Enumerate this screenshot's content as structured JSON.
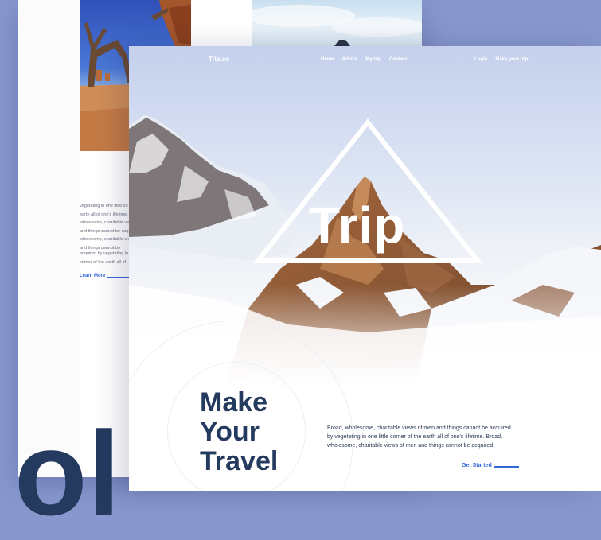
{
  "nav": {
    "brand": "Trip.co",
    "links": [
      "Home",
      "Advice",
      "My trip",
      "Contact"
    ],
    "login": "Login",
    "make_trip": "Make your trip"
  },
  "hero": {
    "title": "Trip"
  },
  "main": {
    "headline_lines": [
      "Make",
      "Your",
      "Travel"
    ],
    "body": "Broad, wholesome, charitable views of men and things cannot be acquired by vegetating in one little corner of the earth all of one's lifetime. Broad, wholesome, charitable views of men and things cannot be acquired.",
    "cta": "Get Started"
  },
  "back_page": {
    "text_block_1": [
      "vegetating in one little co",
      "earth all of one's lifetime.",
      "wholesome, charitable view",
      "and things cannot be acqu",
      "wholesome, charitable view",
      "and things cannot be"
    ],
    "text_block_2": [
      "acquired by vegetating in o",
      "corner of the earth all of"
    ],
    "link": "Learn More",
    "big_letter": "ol"
  },
  "colors": {
    "background": "#8898cf",
    "navy": "#243a5e",
    "accent_blue": "#3566d8"
  }
}
